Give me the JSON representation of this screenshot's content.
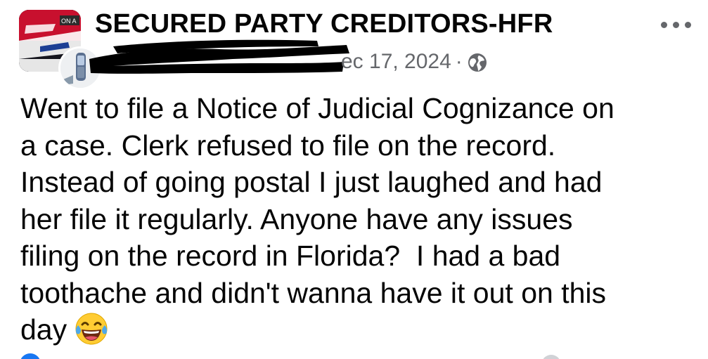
{
  "post": {
    "group_name": "SECURED PARTY CREDITORS-HFR",
    "timestamp": "ec 17, 2024",
    "separator": "·",
    "privacy_icon": "globe-icon",
    "more_icon": "more-options-icon",
    "group_avatar_text": "ON A",
    "body_text": "Went to file a Notice of Judicial Cognizance on\na case. Clerk refused to file on the record.\nInstead of going postal I just laughed and had\nher file it regularly. Anyone have any issues\nfiling on the record in Florida?  I had a bad\ntoothache and didn't wanna have it out on this\nday",
    "emoji": "face-with-tears-of-joy"
  },
  "colors": {
    "text_primary": "#050505",
    "text_secondary": "#65676b",
    "background": "#ffffff",
    "facebook_blue": "#1877f2",
    "emoji_yellow": "#ffcc33"
  }
}
